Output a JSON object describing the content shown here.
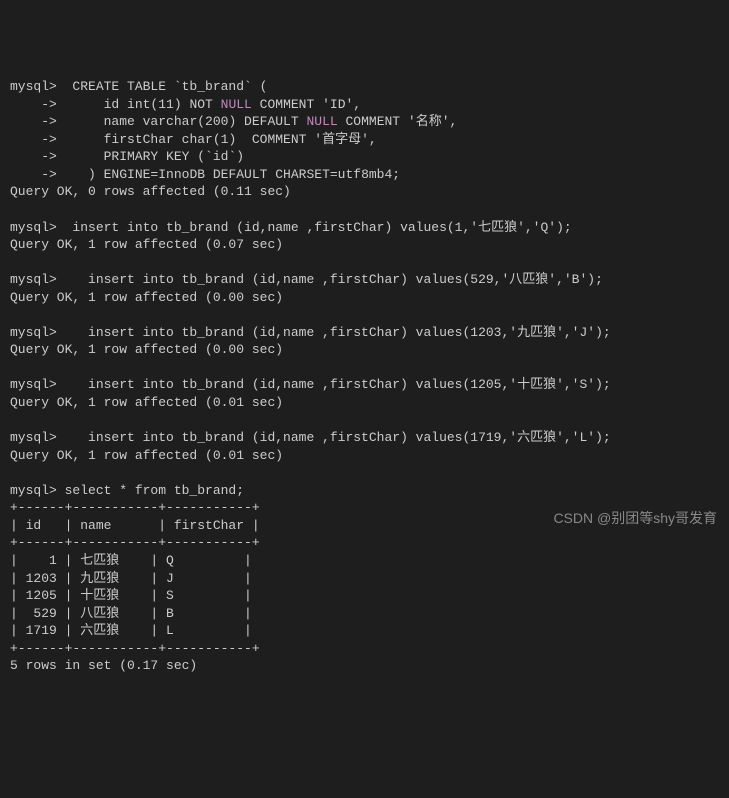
{
  "lines": [
    {
      "segs": [
        {
          "t": "mysql>  CREATE TABLE `tb_brand` ("
        }
      ]
    },
    {
      "segs": [
        {
          "t": "    ->      id int(11) NOT "
        },
        {
          "t": "NULL",
          "cls": "kw"
        },
        {
          "t": " COMMENT 'ID',"
        }
      ]
    },
    {
      "segs": [
        {
          "t": "    ->      name varchar(200) DEFAULT "
        },
        {
          "t": "NULL",
          "cls": "kw"
        },
        {
          "t": " COMMENT '名称',"
        }
      ]
    },
    {
      "segs": [
        {
          "t": "    ->      firstChar char(1)  COMMENT '首字母',"
        }
      ]
    },
    {
      "segs": [
        {
          "t": "    ->      PRIMARY KEY (`id`)"
        }
      ]
    },
    {
      "segs": [
        {
          "t": "    ->    ) ENGINE=InnoDB DEFAULT CHARSET=utf8mb4;"
        }
      ]
    },
    {
      "segs": [
        {
          "t": "Query OK, 0 rows affected (0.11 sec)"
        }
      ]
    },
    {
      "segs": [
        {
          "t": ""
        }
      ]
    },
    {
      "segs": [
        {
          "t": "mysql>  insert into tb_brand (id,name ,firstChar) values(1,'七匹狼','Q');"
        }
      ]
    },
    {
      "segs": [
        {
          "t": "Query OK, 1 row affected (0.07 sec)"
        }
      ]
    },
    {
      "segs": [
        {
          "t": ""
        }
      ]
    },
    {
      "segs": [
        {
          "t": "mysql>    insert into tb_brand (id,name ,firstChar) values(529,'八匹狼','B');"
        }
      ]
    },
    {
      "segs": [
        {
          "t": "Query OK, 1 row affected (0.00 sec)"
        }
      ]
    },
    {
      "segs": [
        {
          "t": ""
        }
      ]
    },
    {
      "segs": [
        {
          "t": "mysql>    insert into tb_brand (id,name ,firstChar) values(1203,'九匹狼','J');"
        }
      ]
    },
    {
      "segs": [
        {
          "t": "Query OK, 1 row affected (0.00 sec)"
        }
      ]
    },
    {
      "segs": [
        {
          "t": ""
        }
      ]
    },
    {
      "segs": [
        {
          "t": "mysql>    insert into tb_brand (id,name ,firstChar) values(1205,'十匹狼','S');"
        }
      ]
    },
    {
      "segs": [
        {
          "t": "Query OK, 1 row affected (0.01 sec)"
        }
      ]
    },
    {
      "segs": [
        {
          "t": ""
        }
      ]
    },
    {
      "segs": [
        {
          "t": "mysql>    insert into tb_brand (id,name ,firstChar) values(1719,'六匹狼','L');"
        }
      ]
    },
    {
      "segs": [
        {
          "t": "Query OK, 1 row affected (0.01 sec)"
        }
      ]
    },
    {
      "segs": [
        {
          "t": ""
        }
      ]
    },
    {
      "segs": [
        {
          "t": "mysql> select * from tb_brand;"
        }
      ]
    },
    {
      "segs": [
        {
          "t": "+------+-----------+-----------+"
        }
      ]
    },
    {
      "segs": [
        {
          "t": "| id   | name      | firstChar |"
        }
      ]
    },
    {
      "segs": [
        {
          "t": "+------+-----------+-----------+"
        }
      ]
    },
    {
      "segs": [
        {
          "t": "|    1 | 七匹狼    | Q         |"
        }
      ]
    },
    {
      "segs": [
        {
          "t": "| 1203 | 九匹狼    | J         |"
        }
      ]
    },
    {
      "segs": [
        {
          "t": "| 1205 | 十匹狼    | S         |"
        }
      ]
    },
    {
      "segs": [
        {
          "t": "|  529 | 八匹狼    | B         |"
        }
      ]
    },
    {
      "segs": [
        {
          "t": "| 1719 | 六匹狼    | L         |"
        }
      ]
    },
    {
      "segs": [
        {
          "t": "+------+-----------+-----------+"
        }
      ]
    },
    {
      "segs": [
        {
          "t": "5 rows in set (0.17 sec)"
        }
      ]
    }
  ],
  "watermark": "CSDN @别团等shy哥发育"
}
